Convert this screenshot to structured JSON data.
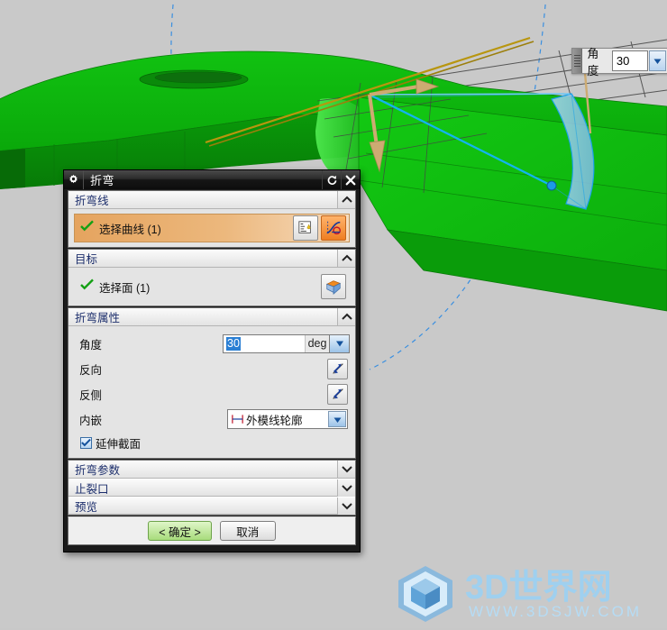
{
  "viewport": {
    "background_color": "#c9c9c9",
    "part_color": "#0bb10b",
    "preview_color": "#6fb8e8",
    "selected_edge_color": "#12b5f0",
    "arrow_color": "#cdab72",
    "bend_line_color": "#b8960f",
    "construction_color": "#3a8fe0"
  },
  "hud": {
    "label": "角度",
    "value": "30",
    "arrow_icon": "chevron-down-icon",
    "grip_icon": "drag-grip-icon"
  },
  "dialog": {
    "title": "折弯",
    "gear_icon": "gear-icon",
    "reset_icon": "reset-icon",
    "close_icon": "close-icon",
    "sections": {
      "bend_line": {
        "title": "折弯线",
        "collapse_icon": "chevron-up-icon",
        "select_label": "选择曲线 (1)",
        "check_icon": "check-icon",
        "curve_rule_icon": "curve-rule-icon",
        "select_curve_icon": "select-curve-icon"
      },
      "target": {
        "title": "目标",
        "collapse_icon": "chevron-up-icon",
        "select_label": "选择面 (1)",
        "check_icon": "check-icon",
        "select_face_icon": "select-face-icon"
      },
      "bend_properties": {
        "title": "折弯属性",
        "collapse_icon": "chevron-up-icon",
        "angle_label": "角度",
        "angle_value": "30",
        "angle_unit": "deg",
        "angle_arrow_icon": "chevron-down-icon",
        "reverse_direction_label": "反向",
        "reverse_direction_icon": "flip-direction-icon",
        "reverse_side_label": "反侧",
        "reverse_side_icon": "flip-side-icon",
        "inset_label": "内嵌",
        "inset_value": "外模线轮廓",
        "inset_icon": "dimension-icon",
        "inset_arrow_icon": "chevron-down-icon",
        "extend_section_label": "延伸截面",
        "extend_section_checked": true,
        "checkbox_icon": "checkbox-checked-icon"
      }
    },
    "collapsed_sections": [
      {
        "title": "折弯参数",
        "expand_icon": "chevron-down-icon"
      },
      {
        "title": "止裂口",
        "expand_icon": "chevron-down-icon"
      },
      {
        "title": "预览",
        "expand_icon": "chevron-down-icon"
      }
    ],
    "footer": {
      "ok_label": "< 确定 >",
      "cancel_label": "取消"
    }
  },
  "watermark": {
    "brand": "3D世界网",
    "url": "WWW.3DSJW.COM",
    "logo_icon": "cube-logo-icon"
  }
}
